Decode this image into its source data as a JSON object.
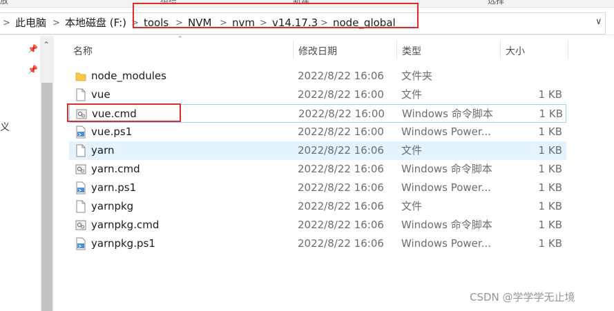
{
  "ribbon": [
    "放",
    "组织",
    "新建",
    "选择"
  ],
  "breadcrumb": [
    "此电脑",
    "本地磁盘 (F:)",
    "tools",
    "NVM",
    "nvm",
    "v14.17.3",
    "node_global"
  ],
  "nav": {
    "partial_text": "义"
  },
  "columns": {
    "name": "名称",
    "date": "修改日期",
    "type": "类型",
    "size": "大小"
  },
  "files": [
    {
      "name": "node_modules",
      "date": "2022/8/22 16:06",
      "type": "文件夹",
      "size": "",
      "icon": "folder-icon"
    },
    {
      "name": "vue",
      "date": "2022/8/22 16:00",
      "type": "文件",
      "size": "1 KB",
      "icon": "file-icon"
    },
    {
      "name": "vue.cmd",
      "date": "2022/8/22 16:00",
      "type": "Windows 命令脚本",
      "size": "1 KB",
      "icon": "cmd-script-icon"
    },
    {
      "name": "vue.ps1",
      "date": "2022/8/22 16:00",
      "type": "Windows Power...",
      "size": "1 KB",
      "icon": "powershell-script-icon"
    },
    {
      "name": "yarn",
      "date": "2022/8/22 16:06",
      "type": "文件",
      "size": "1 KB",
      "icon": "file-icon"
    },
    {
      "name": "yarn.cmd",
      "date": "2022/8/22 16:06",
      "type": "Windows 命令脚本",
      "size": "1 KB",
      "icon": "cmd-script-icon"
    },
    {
      "name": "yarn.ps1",
      "date": "2022/8/22 16:06",
      "type": "Windows Power...",
      "size": "1 KB",
      "icon": "powershell-script-icon"
    },
    {
      "name": "yarnpkg",
      "date": "2022/8/22 16:06",
      "type": "文件",
      "size": "1 KB",
      "icon": "file-icon"
    },
    {
      "name": "yarnpkg.cmd",
      "date": "2022/8/22 16:06",
      "type": "Windows 命令脚本",
      "size": "1 KB",
      "icon": "cmd-script-icon"
    },
    {
      "name": "yarnpkg.ps1",
      "date": "2022/8/22 16:06",
      "type": "Windows Power...",
      "size": "1 KB",
      "icon": "powershell-script-icon"
    }
  ],
  "watermark": "CSDN @学学学无止境",
  "colors": {
    "annotation": "#e02a2a",
    "selection": "#cce8ff",
    "hover": "#e5f3ff",
    "folder": "#f8c84a"
  }
}
